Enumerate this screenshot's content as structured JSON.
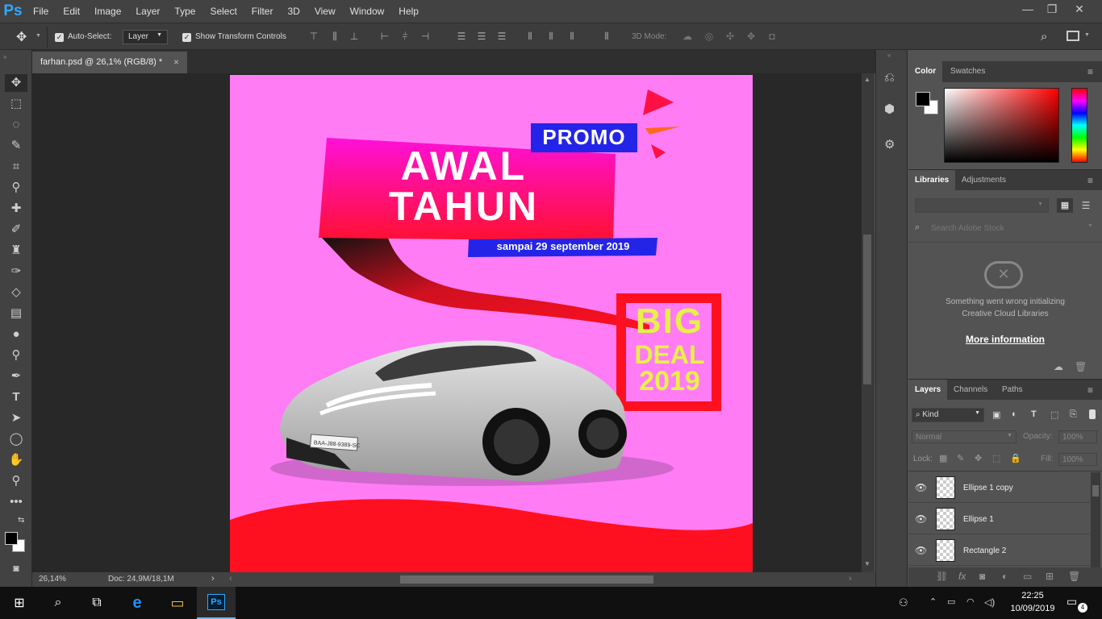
{
  "app": {
    "logo": "Ps",
    "accent": "#31a8ff"
  },
  "menu": [
    "File",
    "Edit",
    "Image",
    "Layer",
    "Type",
    "Select",
    "Filter",
    "3D",
    "View",
    "Window",
    "Help"
  ],
  "window_controls": {
    "minimize": "—",
    "restore": "❐",
    "close": "✕"
  },
  "options": {
    "auto_select_label": "Auto-Select:",
    "auto_select_value": "Layer",
    "show_transform_label": "Show Transform Controls",
    "mode_3d_label": "3D Mode:"
  },
  "document": {
    "tab_title": "farhan.psd @ 26,1% (RGB/8) *",
    "tab_close": "×"
  },
  "status": {
    "zoom": "26,14%",
    "doc": "Doc: 24,9M/18,1M"
  },
  "design": {
    "promo": "PROMO",
    "headline_1": "AWAL",
    "headline_2": "TAHUN",
    "date_banner": "sampai 29 september 2019",
    "deal_1": "BIG",
    "deal_2": "DEAL",
    "deal_3": "2019",
    "plate": "BAA-J88-9389-SC",
    "background_color": "#ff7cf5",
    "red": "#ff1020",
    "yellow": "#e8f048",
    "blue": "#2424e8"
  },
  "panels": {
    "color_tabs": [
      "Color",
      "Swatches"
    ],
    "library_tabs": [
      "Libraries",
      "Adjustments"
    ],
    "search_placeholder": "Search Adobe Stock",
    "error_line1": "Something went wrong initializing",
    "error_line2": "Creative Cloud Libraries",
    "more_info": "More information",
    "layer_tabs": [
      "Layers",
      "Channels",
      "Paths"
    ],
    "kind_label": "Kind",
    "blend_mode": "Normal",
    "opacity_label": "Opacity:",
    "opacity_value": "100%",
    "lock_label": "Lock:",
    "fill_label": "Fill:",
    "fill_value": "100%"
  },
  "layers": [
    {
      "name": "Ellipse 1 copy"
    },
    {
      "name": "Ellipse 1"
    },
    {
      "name": "Rectangle 2"
    }
  ],
  "taskbar": {
    "time": "22:25",
    "date": "10/09/2019",
    "notifications": "4",
    "ps_label": "Ps"
  }
}
